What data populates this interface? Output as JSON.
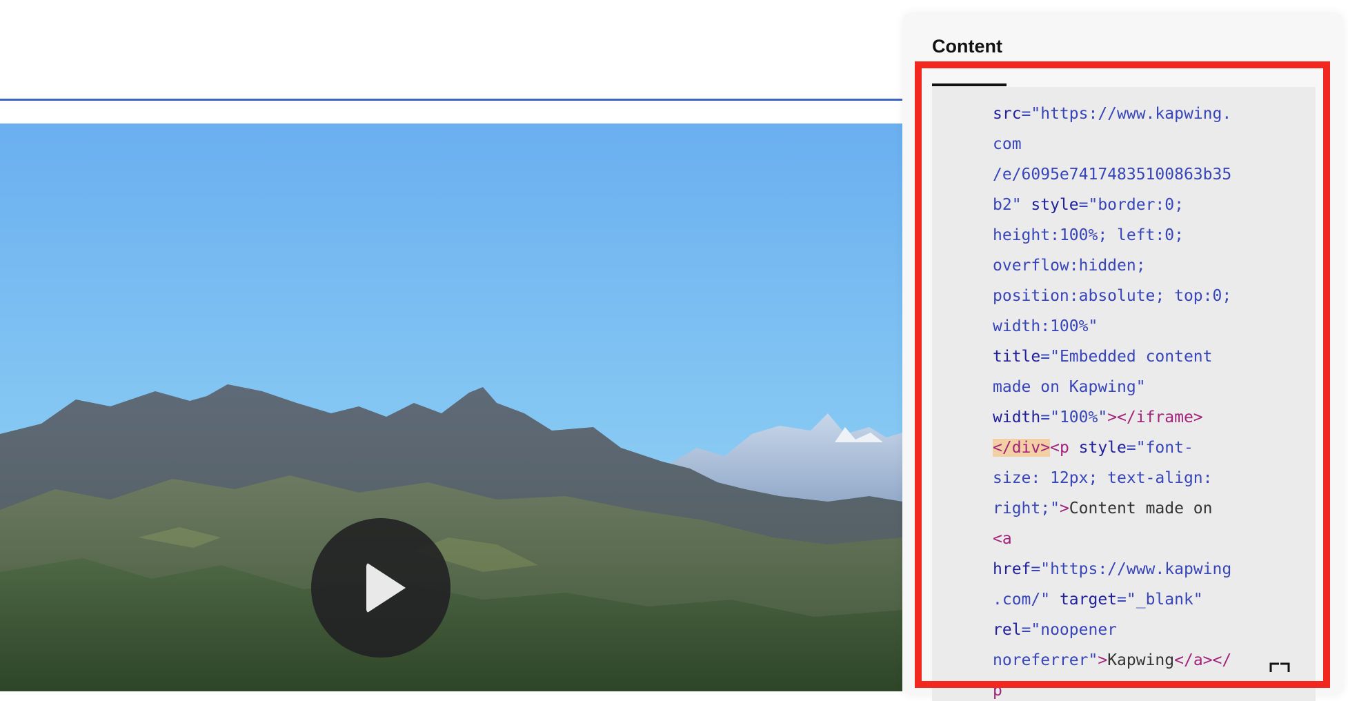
{
  "panel": {
    "title": "Content",
    "code_lines": [
      [
        {
          "t": "src",
          "c": "an"
        },
        {
          "t": "=\"https://www.kapwing.",
          "c": "av"
        }
      ],
      [
        {
          "t": "com",
          "c": "av"
        }
      ],
      [
        {
          "t": "/e/6095e74174835100863b35",
          "c": "av"
        }
      ],
      [
        {
          "t": "b2\" ",
          "c": "av"
        },
        {
          "t": "style",
          "c": "an"
        },
        {
          "t": "=\"border:0;",
          "c": "av"
        }
      ],
      [
        {
          "t": "height:100%; left:0;",
          "c": "av"
        }
      ],
      [
        {
          "t": "overflow:hidden;",
          "c": "av"
        }
      ],
      [
        {
          "t": "position:absolute; top:0;",
          "c": "av"
        }
      ],
      [
        {
          "t": "width:100%\"",
          "c": "av"
        }
      ],
      [
        {
          "t": "title",
          "c": "an"
        },
        {
          "t": "=\"Embedded content",
          "c": "av"
        }
      ],
      [
        {
          "t": "made on Kapwing\"",
          "c": "av"
        }
      ],
      [
        {
          "t": "width",
          "c": "an"
        },
        {
          "t": "=\"100%\"",
          "c": "av"
        },
        {
          "t": "></iframe>",
          "c": "tg"
        }
      ],
      [
        {
          "t": "</div>",
          "c": "tg hl"
        },
        {
          "t": "<p ",
          "c": "tg"
        },
        {
          "t": "style",
          "c": "an"
        },
        {
          "t": "=\"font-",
          "c": "av"
        }
      ],
      [
        {
          "t": "size: 12px; text-align:",
          "c": "av"
        }
      ],
      [
        {
          "t": "right;\"",
          "c": "av"
        },
        {
          "t": ">",
          "c": "tg"
        },
        {
          "t": "Content made on",
          "c": "tx"
        }
      ],
      [
        {
          "t": "<a",
          "c": "tg"
        }
      ],
      [
        {
          "t": "href",
          "c": "an"
        },
        {
          "t": "=\"https://www.kapwing",
          "c": "av"
        }
      ],
      [
        {
          "t": ".com/\" ",
          "c": "av"
        },
        {
          "t": "target",
          "c": "an"
        },
        {
          "t": "=\"_blank\"",
          "c": "av"
        }
      ],
      [
        {
          "t": "rel",
          "c": "an"
        },
        {
          "t": "=\"noopener",
          "c": "av"
        }
      ],
      [
        {
          "t": "noreferrer\"",
          "c": "av"
        },
        {
          "t": ">",
          "c": "tg"
        },
        {
          "t": "Kapwing",
          "c": "tx"
        },
        {
          "t": "</a></",
          "c": "tg"
        }
      ],
      [
        {
          "t": "p",
          "c": "tg"
        }
      ]
    ]
  },
  "video": {
    "play_icon": "play-icon"
  },
  "expand_icon": "expand-icon",
  "colors": {
    "attr_name": "#22209a",
    "attr_value": "#3745b8",
    "tag": "#a1247a",
    "highlight": "#f2cfa5",
    "frame": "#f2281f",
    "rule": "#3d63c6"
  }
}
